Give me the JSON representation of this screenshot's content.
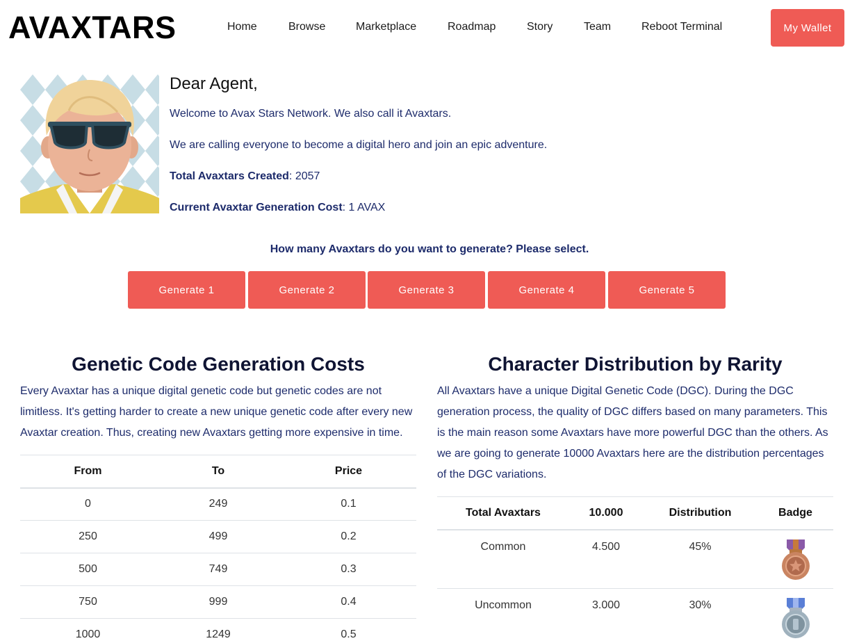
{
  "header": {
    "logo": "AVAXTARS",
    "nav": [
      "Home",
      "Browse",
      "Marketplace",
      "Roadmap",
      "Story",
      "Team",
      "Reboot Terminal"
    ],
    "wallet_button": "My Wallet"
  },
  "intro": {
    "greeting": "Dear Agent,",
    "welcome": "Welcome to Avax Stars Network. We also call it Avaxtars.",
    "calling": "We are calling everyone to become a digital hero and join an epic adventure.",
    "total_label": "Total Avaxtars Created",
    "total_value": ": 2057",
    "cost_label": "Current Avaxtar Generation Cost",
    "cost_value": ": 1 AVAX"
  },
  "generate": {
    "question": "How many Avaxtars do you want to generate? Please select.",
    "buttons": [
      "Generate 1",
      "Generate 2",
      "Generate 3",
      "Generate 4",
      "Generate 5"
    ]
  },
  "costs": {
    "title": "Genetic Code Generation Costs",
    "description": "Every Avaxtar has a unique digital genetic code but genetic codes are not limitless. It's getting harder to create a new unique genetic code after every new Avaxtar creation. Thus, creating new Avaxtars getting more expensive in time.",
    "headers": [
      "From",
      "To",
      "Price"
    ],
    "rows": [
      [
        "0",
        "249",
        "0.1"
      ],
      [
        "250",
        "499",
        "0.2"
      ],
      [
        "500",
        "749",
        "0.3"
      ],
      [
        "750",
        "999",
        "0.4"
      ],
      [
        "1000",
        "1249",
        "0.5"
      ]
    ]
  },
  "rarity": {
    "title": "Character Distribution by Rarity",
    "description": "All Avaxtars have a unique Digital Genetic Code (DGC). During the DGC generation process, the quality of DGC differs based on many parameters. This is the main reason some Avaxtars have more powerful DGC than the others. As we are going to generate 10000 Avaxtars here are the distribution percentages of the DGC variations.",
    "headers": [
      "Total Avaxtars",
      "10.000",
      "Distribution",
      "Badge"
    ],
    "rows": [
      {
        "name": "Common",
        "count": "4.500",
        "pct": "45%",
        "badge": "bronze-medal-icon"
      },
      {
        "name": "Uncommon",
        "count": "3.000",
        "pct": "30%",
        "badge": "silver-medal-icon"
      }
    ]
  },
  "colors": {
    "accent": "#ef5b55",
    "text": "#1d2b6b"
  }
}
